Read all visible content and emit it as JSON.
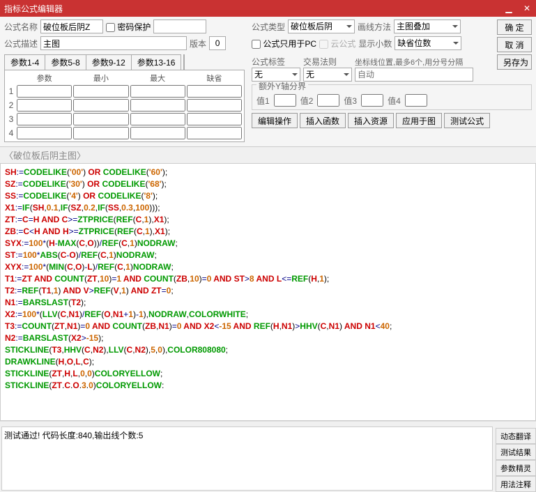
{
  "window": {
    "title": "指标公式编辑器"
  },
  "labels": {
    "formula_name": "公式名称",
    "password_protect": "密码保护",
    "formula_type": "公式类型",
    "draw_method": "画线方法",
    "formula_desc": "公式描述",
    "version": "版本",
    "pc_only": "公式只用于PC",
    "cloud_formula": "云公式",
    "show_decimal": "显示小数",
    "formula_tag": "公式标签",
    "trade_rule": "交易法则",
    "marker_pos": "坐标线位置,最多6个,用分号分隔",
    "marker_placeholder": "自动",
    "extra_y": "额外Y轴分界",
    "v1": "值1",
    "v2": "值2",
    "v3": "值3",
    "v4": "值4"
  },
  "values": {
    "formula_name": "破位板后阴Z",
    "formula_type": "破位板后阴",
    "draw_method": "主图叠加",
    "formula_desc": "主图",
    "version": "0",
    "show_decimal": "缺省位数",
    "tag": "无",
    "rule": "无"
  },
  "buttons": {
    "ok": "确 定",
    "cancel": "取 消",
    "saveas": "另存为",
    "edit_op": "编辑操作",
    "ins_func": "插入函数",
    "ins_res": "插入资源",
    "apply": "应用于图",
    "test": "测试公式",
    "dyn": "动态翻译",
    "result": "测试结果",
    "wizard": "参数精灵",
    "usage": "用法注释"
  },
  "param_tabs": [
    "参数1-4",
    "参数5-8",
    "参数9-12",
    "参数13-16"
  ],
  "param_headers": [
    "参数",
    "最小",
    "最大",
    "缺省"
  ],
  "param_rows": [
    1,
    2,
    3,
    4
  ],
  "editor_header": "〈破位板后阴主图〉",
  "status": "测试通过! 代码长度:840,输出线个数:5",
  "code_lines": [
    [
      [
        "id",
        "SH"
      ],
      [
        "op",
        ":="
      ],
      [
        "fn",
        "CODELIKE"
      ],
      [
        "pn",
        "("
      ],
      [
        "nm",
        "'00'"
      ],
      [
        "pn",
        ")"
      ],
      [
        "kw",
        " OR "
      ],
      [
        "fn",
        "CODELIKE"
      ],
      [
        "pn",
        "("
      ],
      [
        "nm",
        "'60'"
      ],
      [
        "pn",
        ");"
      ]
    ],
    [
      [
        "id",
        "SZ"
      ],
      [
        "op",
        ":="
      ],
      [
        "fn",
        "CODELIKE"
      ],
      [
        "pn",
        "("
      ],
      [
        "nm",
        "'30'"
      ],
      [
        "pn",
        ")"
      ],
      [
        "kw",
        " OR "
      ],
      [
        "fn",
        "CODELIKE"
      ],
      [
        "pn",
        "("
      ],
      [
        "nm",
        "'68'"
      ],
      [
        "pn",
        ");"
      ]
    ],
    [
      [
        "id",
        "SS"
      ],
      [
        "op",
        ":="
      ],
      [
        "fn",
        "CODELIKE"
      ],
      [
        "pn",
        "("
      ],
      [
        "nm",
        "'4'"
      ],
      [
        "pn",
        ")"
      ],
      [
        "kw",
        " OR "
      ],
      [
        "fn",
        "CODELIKE"
      ],
      [
        "pn",
        "("
      ],
      [
        "nm",
        "'8'"
      ],
      [
        "pn",
        ");"
      ]
    ],
    [
      [
        "id",
        "X1"
      ],
      [
        "op",
        ":="
      ],
      [
        "fn",
        "IF"
      ],
      [
        "pn",
        "("
      ],
      [
        "id",
        "SH"
      ],
      [
        "pn",
        ","
      ],
      [
        "nm",
        "0.1"
      ],
      [
        "pn",
        ","
      ],
      [
        "fn",
        "IF"
      ],
      [
        "pn",
        "("
      ],
      [
        "id",
        "SZ"
      ],
      [
        "pn",
        ","
      ],
      [
        "nm",
        "0.2"
      ],
      [
        "pn",
        ","
      ],
      [
        "fn",
        "IF"
      ],
      [
        "pn",
        "("
      ],
      [
        "id",
        "SS"
      ],
      [
        "pn",
        ","
      ],
      [
        "nm",
        "0.3"
      ],
      [
        "pn",
        ","
      ],
      [
        "nm",
        "100"
      ],
      [
        "pn",
        ")));"
      ]
    ],
    [
      [
        "id",
        "ZT"
      ],
      [
        "op",
        ":="
      ],
      [
        "id",
        "C"
      ],
      [
        "op",
        "="
      ],
      [
        "id",
        "H"
      ],
      [
        "kw",
        " AND "
      ],
      [
        "id",
        "C"
      ],
      [
        "op",
        ">="
      ],
      [
        "fn",
        "ZTPRICE"
      ],
      [
        "pn",
        "("
      ],
      [
        "fn",
        "REF"
      ],
      [
        "pn",
        "("
      ],
      [
        "id",
        "C"
      ],
      [
        "pn",
        ","
      ],
      [
        "nm",
        "1"
      ],
      [
        "pn",
        "),"
      ],
      [
        "id",
        "X1"
      ],
      [
        "pn",
        ");"
      ]
    ],
    [
      [
        "id",
        "ZB"
      ],
      [
        "op",
        ":="
      ],
      [
        "id",
        "C"
      ],
      [
        "op",
        "<"
      ],
      [
        "id",
        "H"
      ],
      [
        "kw",
        " AND "
      ],
      [
        "id",
        "H"
      ],
      [
        "op",
        ">="
      ],
      [
        "fn",
        "ZTPRICE"
      ],
      [
        "pn",
        "("
      ],
      [
        "fn",
        "REF"
      ],
      [
        "pn",
        "("
      ],
      [
        "id",
        "C"
      ],
      [
        "pn",
        ","
      ],
      [
        "nm",
        "1"
      ],
      [
        "pn",
        "),"
      ],
      [
        "id",
        "X1"
      ],
      [
        "pn",
        ");"
      ]
    ],
    [
      [
        "id",
        "SYX"
      ],
      [
        "op",
        ":="
      ],
      [
        "nm",
        "100"
      ],
      [
        "op",
        "*"
      ],
      [
        "pn",
        "("
      ],
      [
        "id",
        "H"
      ],
      [
        "op",
        "-"
      ],
      [
        "fn",
        "MAX"
      ],
      [
        "pn",
        "("
      ],
      [
        "id",
        "C"
      ],
      [
        "pn",
        ","
      ],
      [
        "id",
        "O"
      ],
      [
        "pn",
        "))"
      ],
      [
        "op",
        "/"
      ],
      [
        "fn",
        "REF"
      ],
      [
        "pn",
        "("
      ],
      [
        "id",
        "C"
      ],
      [
        "pn",
        ","
      ],
      [
        "nm",
        "1"
      ],
      [
        "pn",
        ")"
      ],
      [
        "fn",
        "NODRAW"
      ],
      [
        "pn",
        ";"
      ]
    ],
    [
      [
        "id",
        "ST"
      ],
      [
        "op",
        ":="
      ],
      [
        "nm",
        "100"
      ],
      [
        "op",
        "*"
      ],
      [
        "fn",
        "ABS"
      ],
      [
        "pn",
        "("
      ],
      [
        "id",
        "C"
      ],
      [
        "op",
        "-"
      ],
      [
        "id",
        "O"
      ],
      [
        "pn",
        ")"
      ],
      [
        "op",
        "/"
      ],
      [
        "fn",
        "REF"
      ],
      [
        "pn",
        "("
      ],
      [
        "id",
        "C"
      ],
      [
        "pn",
        ","
      ],
      [
        "nm",
        "1"
      ],
      [
        "pn",
        ")"
      ],
      [
        "fn",
        "NODRAW"
      ],
      [
        "pn",
        ";"
      ]
    ],
    [
      [
        "id",
        "XYX"
      ],
      [
        "op",
        ":="
      ],
      [
        "nm",
        "100"
      ],
      [
        "op",
        "*"
      ],
      [
        "pn",
        "("
      ],
      [
        "fn",
        "MIN"
      ],
      [
        "pn",
        "("
      ],
      [
        "id",
        "C"
      ],
      [
        "pn",
        ","
      ],
      [
        "id",
        "O"
      ],
      [
        "pn",
        ")"
      ],
      [
        "op",
        "-"
      ],
      [
        "id",
        "L"
      ],
      [
        "pn",
        ")"
      ],
      [
        "op",
        "/"
      ],
      [
        "fn",
        "REF"
      ],
      [
        "pn",
        "("
      ],
      [
        "id",
        "C"
      ],
      [
        "pn",
        ","
      ],
      [
        "nm",
        "1"
      ],
      [
        "pn",
        ")"
      ],
      [
        "fn",
        "NODRAW"
      ],
      [
        "pn",
        ";"
      ]
    ],
    [
      [
        "id",
        "T1"
      ],
      [
        "op",
        ":="
      ],
      [
        "id",
        "ZT"
      ],
      [
        "kw",
        " AND "
      ],
      [
        "fn",
        "COUNT"
      ],
      [
        "pn",
        "("
      ],
      [
        "id",
        "ZT"
      ],
      [
        "pn",
        ","
      ],
      [
        "nm",
        "10"
      ],
      [
        "pn",
        ")"
      ],
      [
        "op",
        "="
      ],
      [
        "nm",
        "1"
      ],
      [
        "kw",
        " AND "
      ],
      [
        "fn",
        "COUNT"
      ],
      [
        "pn",
        "("
      ],
      [
        "id",
        "ZB"
      ],
      [
        "pn",
        ","
      ],
      [
        "nm",
        "10"
      ],
      [
        "pn",
        ")"
      ],
      [
        "op",
        "="
      ],
      [
        "nm",
        "0"
      ],
      [
        "kw",
        " AND "
      ],
      [
        "id",
        "ST"
      ],
      [
        "op",
        ">"
      ],
      [
        "nm",
        "8"
      ],
      [
        "kw",
        " AND "
      ],
      [
        "id",
        "L"
      ],
      [
        "op",
        "<="
      ],
      [
        "fn",
        "REF"
      ],
      [
        "pn",
        "("
      ],
      [
        "id",
        "H"
      ],
      [
        "pn",
        ","
      ],
      [
        "nm",
        "1"
      ],
      [
        "pn",
        ");"
      ]
    ],
    [
      [
        "id",
        "T2"
      ],
      [
        "op",
        ":="
      ],
      [
        "fn",
        "REF"
      ],
      [
        "pn",
        "("
      ],
      [
        "id",
        "T1"
      ],
      [
        "pn",
        ","
      ],
      [
        "nm",
        "1"
      ],
      [
        "pn",
        ")"
      ],
      [
        "kw",
        " AND "
      ],
      [
        "id",
        "V"
      ],
      [
        "op",
        ">"
      ],
      [
        "fn",
        "REF"
      ],
      [
        "pn",
        "("
      ],
      [
        "id",
        "V"
      ],
      [
        "pn",
        ","
      ],
      [
        "nm",
        "1"
      ],
      [
        "pn",
        ")"
      ],
      [
        "kw",
        " AND "
      ],
      [
        "id",
        "ZT"
      ],
      [
        "op",
        "="
      ],
      [
        "nm",
        "0"
      ],
      [
        "pn",
        ";"
      ]
    ],
    [
      [
        "id",
        "N1"
      ],
      [
        "op",
        ":="
      ],
      [
        "fn",
        "BARSLAST"
      ],
      [
        "pn",
        "("
      ],
      [
        "id",
        "T2"
      ],
      [
        "pn",
        ");"
      ]
    ],
    [
      [
        "id",
        "X2"
      ],
      [
        "op",
        ":="
      ],
      [
        "nm",
        "100"
      ],
      [
        "op",
        "*"
      ],
      [
        "pn",
        "("
      ],
      [
        "fn",
        "LLV"
      ],
      [
        "pn",
        "("
      ],
      [
        "id",
        "C"
      ],
      [
        "pn",
        ","
      ],
      [
        "id",
        "N1"
      ],
      [
        "pn",
        ")"
      ],
      [
        "op",
        "/"
      ],
      [
        "fn",
        "REF"
      ],
      [
        "pn",
        "("
      ],
      [
        "id",
        "O"
      ],
      [
        "pn",
        ","
      ],
      [
        "id",
        "N1"
      ],
      [
        "op",
        "+"
      ],
      [
        "nm",
        "1"
      ],
      [
        "pn",
        ")"
      ],
      [
        "op",
        "-"
      ],
      [
        "nm",
        "1"
      ],
      [
        "pn",
        "),"
      ],
      [
        "fn",
        "NODRAW"
      ],
      [
        "pn",
        ","
      ],
      [
        "fn",
        "COLORWHITE"
      ],
      [
        "pn",
        ";"
      ]
    ],
    [
      [
        "id",
        "T3"
      ],
      [
        "op",
        ":="
      ],
      [
        "fn",
        "COUNT"
      ],
      [
        "pn",
        "("
      ],
      [
        "id",
        "ZT"
      ],
      [
        "pn",
        ","
      ],
      [
        "id",
        "N1"
      ],
      [
        "pn",
        ")"
      ],
      [
        "op",
        "="
      ],
      [
        "nm",
        "0"
      ],
      [
        "kw",
        " AND "
      ],
      [
        "fn",
        "COUNT"
      ],
      [
        "pn",
        "("
      ],
      [
        "id",
        "ZB"
      ],
      [
        "pn",
        ","
      ],
      [
        "id",
        "N1"
      ],
      [
        "pn",
        ")"
      ],
      [
        "op",
        "="
      ],
      [
        "nm",
        "0"
      ],
      [
        "kw",
        " AND "
      ],
      [
        "id",
        "X2"
      ],
      [
        "op",
        "<"
      ],
      [
        "nm",
        "-15"
      ],
      [
        "kw",
        " AND "
      ],
      [
        "fn",
        "REF"
      ],
      [
        "pn",
        "("
      ],
      [
        "id",
        "H"
      ],
      [
        "pn",
        ","
      ],
      [
        "id",
        "N1"
      ],
      [
        "pn",
        ")"
      ],
      [
        "op",
        ">"
      ],
      [
        "fn",
        "HHV"
      ],
      [
        "pn",
        "("
      ],
      [
        "id",
        "C"
      ],
      [
        "pn",
        ","
      ],
      [
        "id",
        "N1"
      ],
      [
        "pn",
        ")"
      ],
      [
        "kw",
        " AND "
      ],
      [
        "id",
        "N1"
      ],
      [
        "op",
        "<"
      ],
      [
        "nm",
        "40"
      ],
      [
        "pn",
        ";"
      ]
    ],
    [
      [
        "id",
        "N2"
      ],
      [
        "op",
        ":="
      ],
      [
        "fn",
        "BARSLAST"
      ],
      [
        "pn",
        "("
      ],
      [
        "id",
        "X2"
      ],
      [
        "op",
        ">"
      ],
      [
        "nm",
        "-15"
      ],
      [
        "pn",
        ");"
      ]
    ],
    [
      [
        "fn",
        "STICKLINE"
      ],
      [
        "pn",
        "("
      ],
      [
        "id",
        "T3"
      ],
      [
        "pn",
        ","
      ],
      [
        "fn",
        "HHV"
      ],
      [
        "pn",
        "("
      ],
      [
        "id",
        "C"
      ],
      [
        "pn",
        ","
      ],
      [
        "id",
        "N2"
      ],
      [
        "pn",
        "),"
      ],
      [
        "fn",
        "LLV"
      ],
      [
        "pn",
        "("
      ],
      [
        "id",
        "C"
      ],
      [
        "pn",
        ","
      ],
      [
        "id",
        "N2"
      ],
      [
        "pn",
        "),"
      ],
      [
        "nm",
        "5"
      ],
      [
        "pn",
        ","
      ],
      [
        "nm",
        "0"
      ],
      [
        "pn",
        "),"
      ],
      [
        "fn",
        "COLOR808080"
      ],
      [
        "pn",
        ";"
      ]
    ],
    [
      [
        "fn",
        "DRAWKLINE"
      ],
      [
        "pn",
        "("
      ],
      [
        "id",
        "H"
      ],
      [
        "pn",
        ","
      ],
      [
        "id",
        "O"
      ],
      [
        "pn",
        ","
      ],
      [
        "id",
        "L"
      ],
      [
        "pn",
        ","
      ],
      [
        "id",
        "C"
      ],
      [
        "pn",
        ");"
      ]
    ],
    [
      [
        "fn",
        "STICKLINE"
      ],
      [
        "pn",
        "("
      ],
      [
        "id",
        "ZT"
      ],
      [
        "pn",
        ","
      ],
      [
        "id",
        "H"
      ],
      [
        "pn",
        ","
      ],
      [
        "id",
        "L"
      ],
      [
        "pn",
        ","
      ],
      [
        "nm",
        "0"
      ],
      [
        "pn",
        ","
      ],
      [
        "nm",
        "0"
      ],
      [
        "pn",
        ")"
      ],
      [
        "fn",
        "COLORYELLOW"
      ],
      [
        "pn",
        ";"
      ]
    ],
    [
      [
        "fn",
        "STICKLINE"
      ],
      [
        "pn",
        "("
      ],
      [
        "id",
        "ZT"
      ],
      [
        "pn",
        "."
      ],
      [
        "id",
        "C"
      ],
      [
        "pn",
        "."
      ],
      [
        "id",
        "O"
      ],
      [
        "pn",
        "."
      ],
      [
        "nm",
        "3"
      ],
      [
        "pn",
        "."
      ],
      [
        "nm",
        "0"
      ],
      [
        "pn",
        ")"
      ],
      [
        "fn",
        "COLORYELLOW"
      ],
      [
        "pn",
        ":"
      ]
    ]
  ]
}
